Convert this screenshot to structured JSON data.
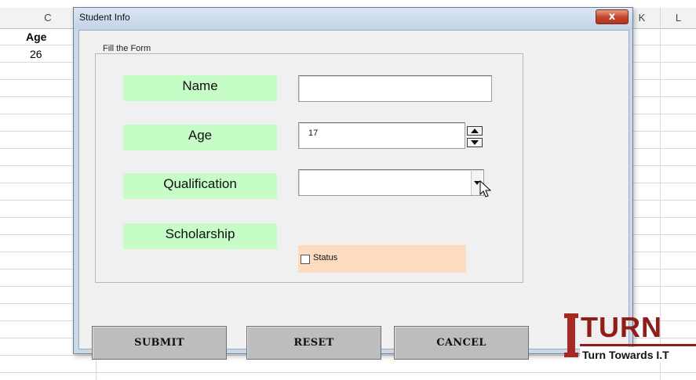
{
  "sheet": {
    "columns": [
      "C",
      "K",
      "L"
    ],
    "cells": {
      "c_header": "Age",
      "c_value": "26"
    }
  },
  "dialog": {
    "title": "Student Info",
    "close_label": "x",
    "frame_caption": "Fill the Form",
    "fields": {
      "name_label": "Name",
      "name_value": "",
      "age_label": "Age",
      "age_value": "17",
      "qualification_label": "Qualification",
      "qualification_value": "",
      "scholarship_label": "Scholarship",
      "status_label": "Status",
      "status_checked": false
    },
    "buttons": {
      "submit": "SUBMIT",
      "reset": "RESET",
      "cancel": "CANCEL"
    }
  },
  "logo": {
    "mark": "I",
    "word": "TURN",
    "tagline": "Turn Towards I.T"
  },
  "colors": {
    "label_bg": "#c6fcc6",
    "status_bg": "#fcdbbf",
    "button_bg": "#bdbdbd",
    "logo_red": "#8f1d18"
  }
}
